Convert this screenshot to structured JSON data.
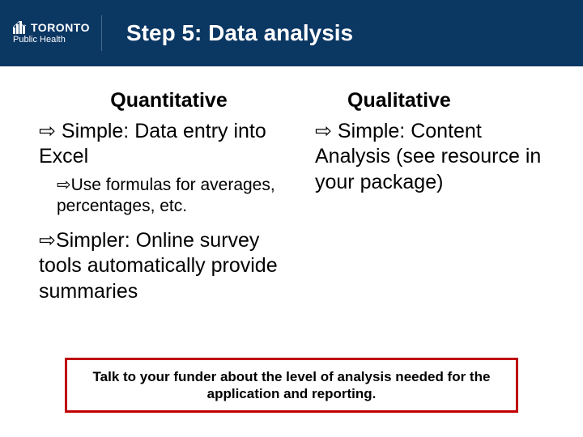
{
  "header": {
    "logo_city": "TORONTO",
    "logo_sub": "Public Health",
    "title": "Step 5: Data analysis"
  },
  "left": {
    "heading": "Quantitative",
    "b1": "⇨ Simple: Data entry into Excel",
    "sub1": "⇨Use formulas for averages, percentages, etc.",
    "b2": "⇨Simpler: Online survey tools automatically provide summaries"
  },
  "right": {
    "heading": "Qualitative",
    "b1": "⇨ Simple: Content Analysis (see resource in your package)"
  },
  "callout": "Talk to your funder about the level of analysis needed for the application and reporting."
}
